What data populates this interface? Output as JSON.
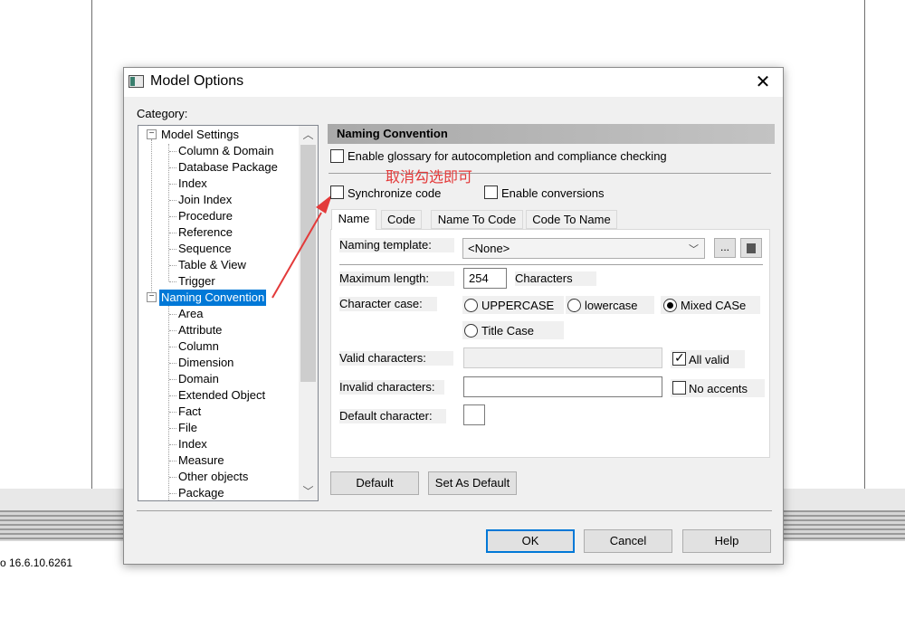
{
  "background": {
    "version_text": "o 16.6.10.6261"
  },
  "dialog": {
    "title": "Model Options",
    "category_label": "Category:",
    "tree": {
      "model_settings": "Model Settings",
      "model_children": [
        "Column & Domain",
        "Database Package",
        "Index",
        "Join Index",
        "Procedure",
        "Reference",
        "Sequence",
        "Table & View",
        "Trigger"
      ],
      "naming_convention": "Naming Convention",
      "naming_children": [
        "Area",
        "Attribute",
        "Column",
        "Dimension",
        "Domain",
        "Extended Object",
        "Fact",
        "File",
        "Index",
        "Measure",
        "Other objects",
        "Package"
      ]
    },
    "section_title": "Naming Convention",
    "enable_glossary": {
      "label": "Enable glossary for autocompletion and compliance checking",
      "checked": false
    },
    "annotation": "取消勾选即可",
    "synchronize_code": {
      "label": "Synchronize code",
      "checked": false
    },
    "enable_conversions": {
      "label": "Enable conversions",
      "checked": false
    },
    "tabs": [
      "Name",
      "Code",
      "Name To Code",
      "Code To Name"
    ],
    "active_tab": "Name",
    "fields": {
      "naming_template_label": "Naming template:",
      "naming_template_value": "<None>",
      "browse_label": "...",
      "max_length_label": "Maximum length:",
      "max_length_value": "254",
      "characters_label": "Characters",
      "character_case_label": "Character case:",
      "case_options": [
        "UPPERCASE",
        "lowercase",
        "Mixed CASe",
        "Title Case"
      ],
      "case_selected": "Mixed CASe",
      "valid_chars_label": "Valid characters:",
      "valid_chars_value": "",
      "all_valid": {
        "label": "All valid",
        "checked": true
      },
      "invalid_chars_label": "Invalid characters:",
      "invalid_chars_value": "",
      "no_accents": {
        "label": "No accents",
        "checked": false
      },
      "default_char_label": "Default character:",
      "default_char_value": ""
    },
    "buttons": {
      "default": "Default",
      "set_as_default": "Set As Default",
      "ok": "OK",
      "cancel": "Cancel",
      "help": "Help"
    },
    "colors": {
      "selection": "#0078d7",
      "annotation": "#e33a3a"
    }
  }
}
